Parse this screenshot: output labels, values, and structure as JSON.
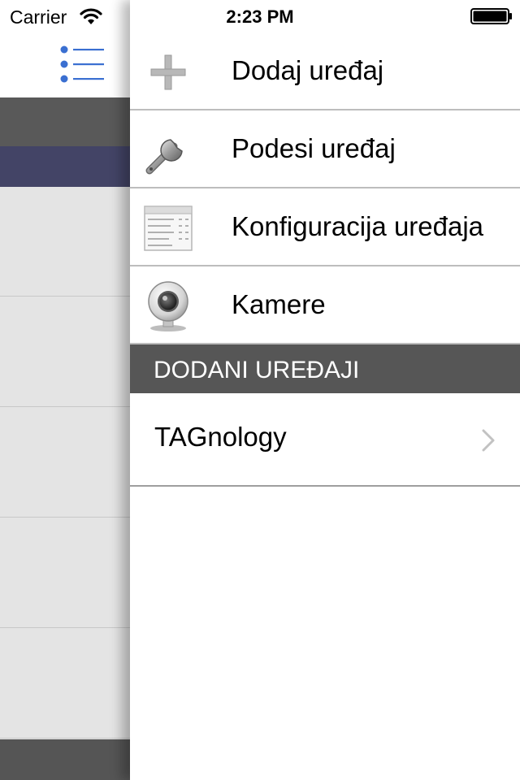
{
  "status_bar": {
    "carrier": "Carrier",
    "time": "2:23 PM",
    "icons": [
      "wifi-icon",
      "battery-icon"
    ]
  },
  "main_view": {
    "menu_toggle_icon": "list-icon",
    "colors": {
      "nav_band": "#595959",
      "selected_row": "#434466",
      "row_background": "#e4e4e4",
      "bottom_bar": "#555555"
    }
  },
  "side_menu": {
    "items": [
      {
        "label": "Dodaj uređaj",
        "icon": "plus-icon"
      },
      {
        "label": "Podesi uređaj",
        "icon": "wrench-icon"
      },
      {
        "label": "Konfiguracija uređaja",
        "icon": "table-icon"
      },
      {
        "label": "Kamere",
        "icon": "webcam-icon"
      }
    ],
    "section_header": "DODANI UREĐAJI",
    "devices": [
      {
        "label": "TAGnology",
        "icon": "chevron-right-icon"
      }
    ],
    "colors": {
      "section_header_bg": "#565656",
      "accent_blue": "#3a6fd1"
    }
  }
}
